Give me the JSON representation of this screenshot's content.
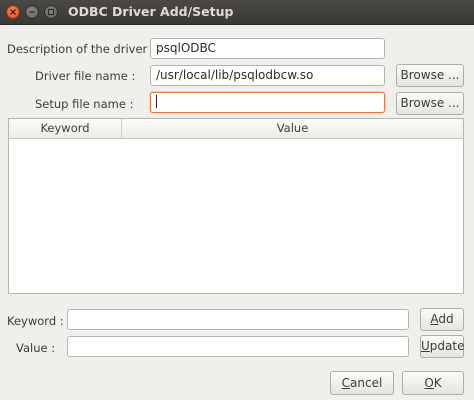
{
  "window": {
    "title": "ODBC Driver Add/Setup"
  },
  "form": {
    "description_label": "Description of the driver :",
    "description_value": "psqlODBC",
    "driver_file_label": "Driver file name :",
    "driver_file_value": "/usr/local/lib/psqlodbcw.so",
    "setup_file_label": "Setup file name :",
    "setup_file_value": "",
    "browse_label": "Browse ..."
  },
  "table": {
    "columns": [
      "Keyword",
      "Value"
    ],
    "rows": []
  },
  "editor": {
    "keyword_label": "Keyword :",
    "keyword_value": "",
    "value_label": "Value :",
    "value_value": "",
    "add_prefix": "A",
    "add_rest": "dd",
    "update_prefix": "U",
    "update_rest": "pdate"
  },
  "footer": {
    "cancel_prefix": "C",
    "cancel_rest": "ancel",
    "ok_prefix": "O",
    "ok_rest": "K"
  },
  "colors": {
    "close_button": "#df4a16",
    "focus_border": "#e07b4a",
    "titlebar": "#3a3935"
  },
  "icons": {
    "close": "close-icon",
    "minimize": "minimize-icon",
    "maximize": "maximize-icon"
  }
}
